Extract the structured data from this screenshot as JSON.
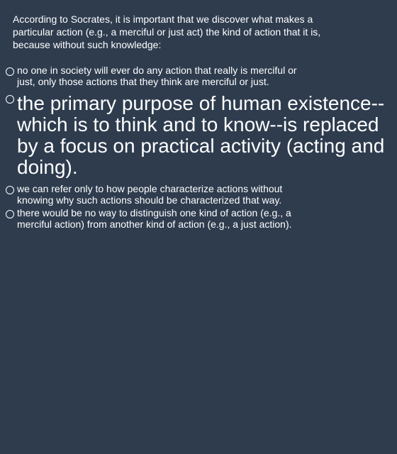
{
  "question": {
    "text": "According to Socrates, it is important that we discover what makes a particular action (e.g., a merciful or just act) the kind of action that it is, because without such knowledge:"
  },
  "options": [
    {
      "label": "no one in society will ever do any action that really is merciful or just, only those actions that they think are merciful or just.",
      "selected": false
    },
    {
      "label": "the primary purpose of human existence--which is to think and to know--is replaced by a focus on practical activity (acting and doing).",
      "selected": false
    },
    {
      "label": "we can refer only to how people characterize actions without knowing why such actions should be characterized that way.",
      "selected": false
    },
    {
      "label": "there would be no way to distinguish one kind of action (e.g., a merciful action) from another kind of action (e.g., a just action).",
      "selected": false
    }
  ]
}
